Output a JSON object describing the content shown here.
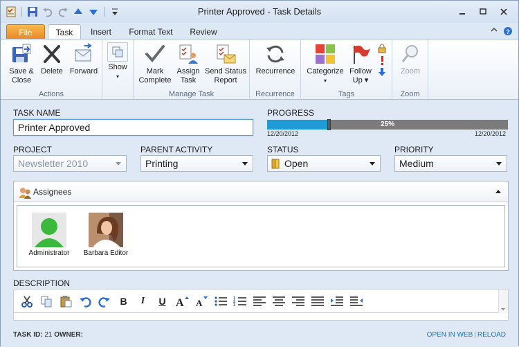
{
  "window": {
    "title": "Printer Approved  - Task Details"
  },
  "tabs": {
    "file": "File",
    "task": "Task",
    "insert": "Insert",
    "format_text": "Format Text",
    "review": "Review"
  },
  "ribbon": {
    "actions": {
      "label": "Actions",
      "save_close": [
        "Save &",
        "Close"
      ],
      "delete": "Delete",
      "forward": "Forward"
    },
    "show": {
      "label": "Show"
    },
    "manage_task": {
      "label": "Manage Task",
      "mark_complete": [
        "Mark",
        "Complete"
      ],
      "assign_task": [
        "Assign",
        "Task"
      ],
      "send_status": [
        "Send Status",
        "Report"
      ]
    },
    "recurrence": {
      "label": "Recurrence",
      "button": "Recurrence"
    },
    "tags": {
      "label": "Tags",
      "categorize": "Categorize",
      "follow_up": [
        "Follow",
        "Up"
      ]
    },
    "zoom": {
      "label": "Zoom",
      "button": "Zoom"
    }
  },
  "form": {
    "task_name_label": "TASK NAME",
    "task_name_value": "Printer Approved",
    "progress_label": "PROGRESS",
    "progress_percent_text": "25%",
    "progress_fraction": 0.25,
    "progress_start": "12/20/2012",
    "progress_end": "12/20/2012",
    "project_label": "PROJECT",
    "project_value": "Newsletter 2010",
    "parent_label": "PARENT ACTIVITY",
    "parent_value": "Printing",
    "status_label": "STATUS",
    "status_value": "Open",
    "priority_label": "PRIORITY",
    "priority_value": "Medium"
  },
  "assignees": {
    "title": "Assignees",
    "people": [
      {
        "name": "Administrator"
      },
      {
        "name": "Barbara Editor"
      }
    ]
  },
  "description": {
    "label": "DESCRIPTION"
  },
  "footer": {
    "task_id_label": "TASK ID:",
    "task_id_value": "21",
    "owner_label": "OWNER:",
    "open_in_web": "OPEN IN WEB",
    "reload": "RELOAD"
  },
  "colors": {
    "accent_blue": "#1f9bd7",
    "file_tab": "#f0a43c",
    "link": "#1a73c9"
  }
}
